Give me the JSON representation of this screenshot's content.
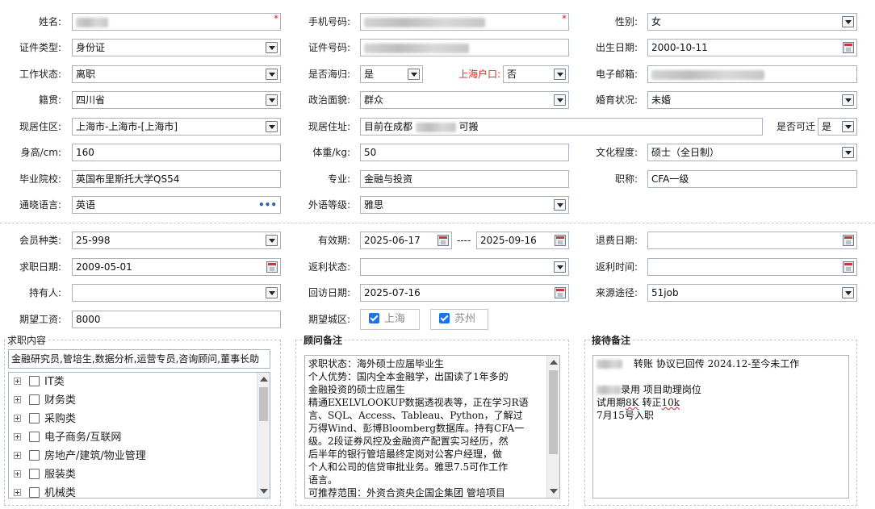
{
  "section1": {
    "name_label": "姓名:",
    "phone_label": "手机号码:",
    "gender_label": "性别:",
    "gender_value": "女",
    "id_type_label": "证件类型:",
    "id_type_value": "身份证",
    "id_no_label": "证件号码:",
    "birth_label": "出生日期:",
    "birth_value": "2000-10-11",
    "work_status_label": "工作状态:",
    "work_status_value": "离职",
    "overseas_label": "是否海归:",
    "overseas_value": "是",
    "hukou_label": "上海户口:",
    "hukou_value": "否",
    "email_label": "电子邮箱:",
    "native_label": "籍贯:",
    "native_value": "四川省",
    "political_label": "政治面貌:",
    "political_value": "群众",
    "marital_label": "婚育状况:",
    "marital_value": "未婚",
    "region_label": "现居住区:",
    "region_value": "上海市-上海市-[上海市]",
    "address_label": "现居住址:",
    "address_prefix": "目前在成都",
    "address_suffix": "可搬",
    "relocate_label": "是否可迁",
    "relocate_value": "是",
    "height_label": "身高/cm:",
    "height_value": "160",
    "weight_label": "体重/kg:",
    "weight_value": "50",
    "edu_label": "文化程度:",
    "edu_value": "硕士（全日制）",
    "school_label": "毕业院校:",
    "school_value": "英国布里斯托大学QS54",
    "major_label": "专业:",
    "major_value": "金融与投资",
    "title_label": "职称:",
    "title_value": "CFA一级",
    "lang_label": "通晓语言:",
    "lang_value": "英语",
    "lang_more": "•••",
    "foreign_label": "外语等级:",
    "foreign_value": "雅思"
  },
  "section2": {
    "member_label": "会员种类:",
    "member_value": "25-998",
    "valid_label": "有效期:",
    "valid_from": "2025-06-17",
    "valid_sep": "----",
    "valid_to": "2025-09-16",
    "refund_date_label": "退费日期:",
    "job_date_label": "求职日期:",
    "job_date_value": "2009-05-01",
    "rebate_status_label": "返利状态:",
    "rebate_time_label": "返利时间:",
    "holder_label": "持有人:",
    "visit_date_label": "回访日期:",
    "visit_date_value": "2025-07-16",
    "source_label": "来源途径:",
    "source_value": "51job",
    "salary_label": "期望工资:",
    "salary_value": "8000",
    "city_label": "期望城区:",
    "city_1": "上海",
    "city_2": "苏州"
  },
  "job_panel": {
    "title": "求职内容",
    "summary": "金融研究员,管培生,数据分析,运营专员,咨询顾问,董事长助",
    "categories": [
      "IT类",
      "财务类",
      "采购类",
      "电子商务/互联网",
      "房地产/建筑/物业管理",
      "服装类",
      "机械类"
    ]
  },
  "consultant_panel": {
    "title": "顾问备注",
    "lines": [
      "求职状态：海外硕士应届毕业生",
      "个人优势：国内全本金融学，出国读了1年多的",
      "金融投资的硕士应届生",
      "精通EXELVLOOKUP数据透视表等，正在学习R语",
      "言、SQL、Access、Tableau、Python，了解过",
      "万得Wind、彭博Bloomberg数据库。持有CFA一",
      "级。2段证券风控及金融资产配置实习经历，然",
      "后半年的银行管培最终定岗对公客户经理，做",
      "个人和公司的信贷审批业务。雅思7.5可作工作",
      "语言。",
      "可推荐范围：外资合资央企国企集团 管培项目"
    ]
  },
  "reception_panel": {
    "title": "接待备注",
    "line1": "转账   协议已回传 2024.12-至今未工作",
    "line2": "录用 项目助理岗位",
    "line3_a": "试用期",
    "line3_b": "8K",
    "line3_c": " 转正",
    "line3_d": "10k",
    "line4": "7月15号入职"
  }
}
